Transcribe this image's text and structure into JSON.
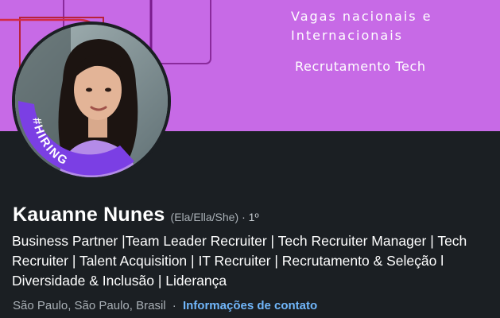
{
  "banner": {
    "line1": "Vagas nacionais e",
    "line2": "Internacionais",
    "line3": "Recrutamento Tech"
  },
  "avatar": {
    "frame_label": "#HIRING",
    "frame_color": "#7b3fe4"
  },
  "profile": {
    "name": "Kauanne Nunes",
    "pronouns": "(Ela/Ella/She)",
    "connection_degree": "· 1º",
    "headline": "Business Partner |Team Leader Recruiter | Tech Recruiter Manager | Tech Recruiter | Talent Acquisition | IT Recruiter | Recrutamento & Seleção l Diversidade & Inclusão | Liderança",
    "location": "São Paulo, São Paulo, Brasil",
    "separator": "·",
    "contact_link": "Informações de contato"
  },
  "colors": {
    "banner_bg": "#c76ae6",
    "card_bg": "#1b1f23",
    "link": "#71b7fb"
  }
}
